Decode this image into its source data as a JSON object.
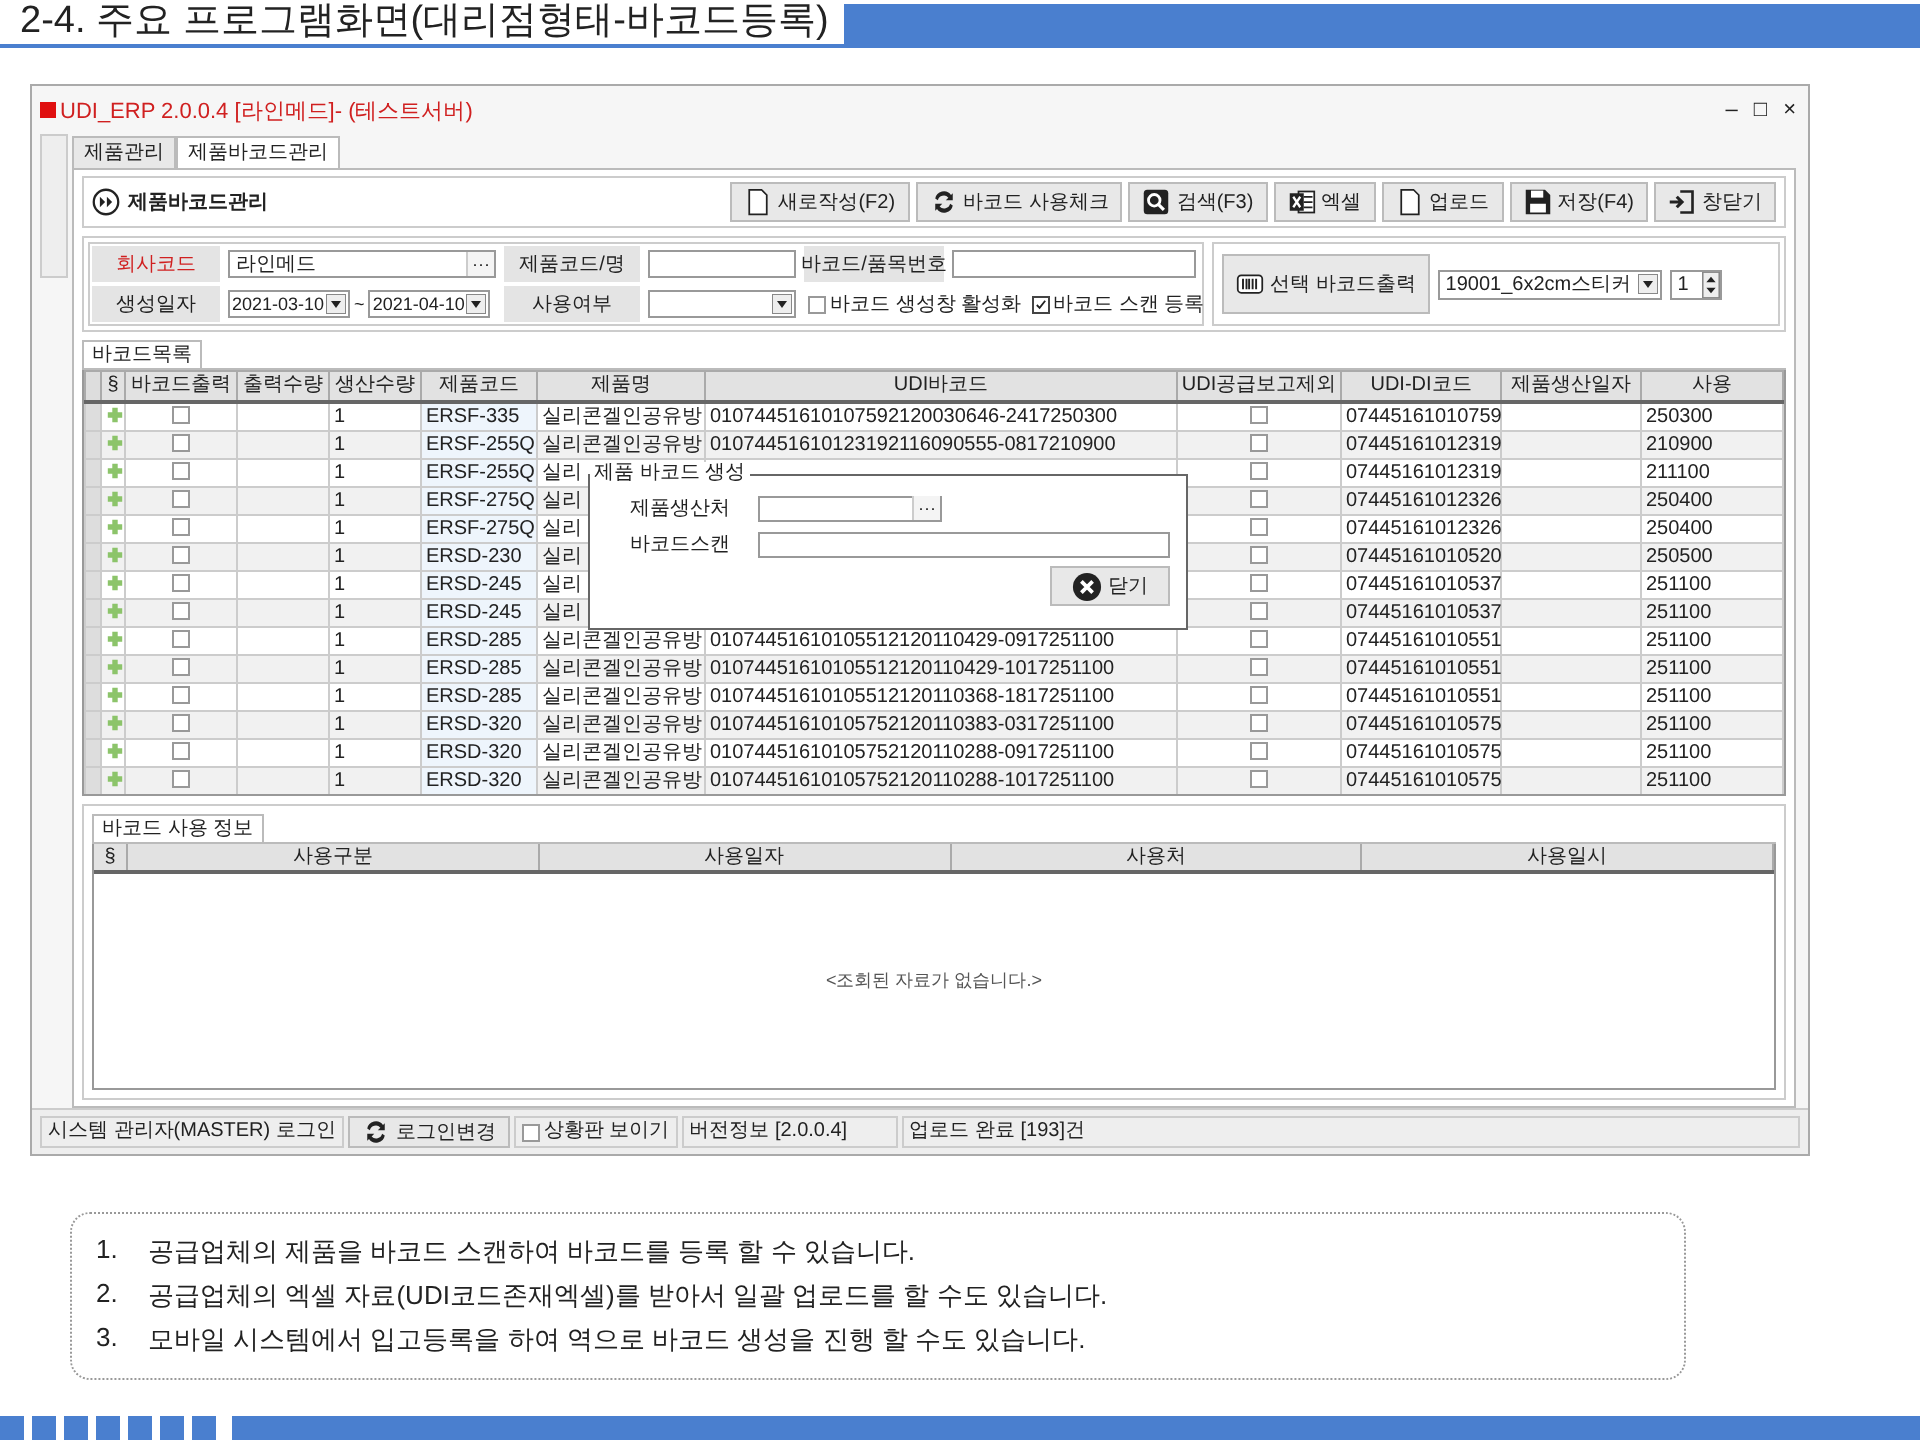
{
  "slide_title": "2-4. 주요 프로그램화면(대리점형태-바코드등록)",
  "window": {
    "title": "UDI_ERP 2.0.0.4 [라인메드]- (테스트서버)",
    "controls": [
      "–",
      "□",
      "×"
    ]
  },
  "tabs": [
    {
      "label": "제품관리",
      "selected": false
    },
    {
      "label": "제품바코드관리",
      "selected": true
    }
  ],
  "panel_title": "제품바코드관리",
  "toolbar": [
    "새로작성(F2)",
    "바코드 사용체크",
    "검색(F3)",
    "엑셀",
    "업로드",
    "저장(F4)",
    "창닫기"
  ],
  "filters": {
    "company": {
      "label": "회사코드",
      "value": "라인메드",
      "button": "···"
    },
    "product": {
      "label": "제품코드/명"
    },
    "barcode_no": {
      "label": "바코드/품목번호"
    },
    "date": {
      "label": "생성일자",
      "from": "2021-03-10",
      "separator": "~",
      "to": "2021-04-10"
    },
    "usage": {
      "label": "사용여부"
    },
    "options": [
      {
        "label": "바코드 생성창 활성화",
        "checked": false
      },
      {
        "label": "바코드 스캔 등록",
        "checked": true
      }
    ]
  },
  "print": {
    "button": "선택 바코드출력",
    "template": "19001_6x2cm스티커",
    "copies": "1"
  },
  "grid_tab": "바코드목록",
  "grid": {
    "columns": [
      "§",
      "바코드출력",
      "출력수량",
      "생산수량",
      "제품코드",
      "제품명",
      "UDI바코드",
      "UDI공급보고제외",
      "UDI-DI코드",
      "제품생산일자",
      "사용"
    ],
    "rows": [
      {
        "print": false,
        "qty": "1",
        "code": "ERSF-335",
        "name": "실리콘겔인공유방",
        "barcode": "01074451610107592120030646-2417250300",
        "exclude": false,
        "di": "07445161010759",
        "use": "250300"
      },
      {
        "print": false,
        "qty": "1",
        "code": "ERSF-255Q",
        "name": "실리콘겔인공유방",
        "barcode": "01074451610123192116090555-0817210900",
        "exclude": false,
        "di": "07445161012319",
        "use": "210900"
      },
      {
        "print": false,
        "qty": "1",
        "code": "ERSF-255Q",
        "name": "실리",
        "exclude": false,
        "di": "07445161012319",
        "use": "211100"
      },
      {
        "print": false,
        "qty": "1",
        "code": "ERSF-275Q",
        "name": "실리",
        "exclude": false,
        "di": "07445161012326",
        "use": "250400"
      },
      {
        "print": false,
        "qty": "1",
        "code": "ERSF-275Q",
        "name": "실리",
        "exclude": false,
        "di": "07445161012326",
        "use": "250400"
      },
      {
        "print": false,
        "qty": "1",
        "code": "ERSD-230",
        "name": "실리",
        "exclude": false,
        "di": "07445161010520",
        "use": "250500"
      },
      {
        "print": false,
        "qty": "1",
        "code": "ERSD-245",
        "name": "실리",
        "exclude": false,
        "di": "07445161010537",
        "use": "251100"
      },
      {
        "print": false,
        "qty": "1",
        "code": "ERSD-245",
        "name": "실리",
        "exclude": false,
        "di": "07445161010537",
        "use": "251100"
      },
      {
        "print": false,
        "qty": "1",
        "code": "ERSD-285",
        "name": "실리콘겔인공유방",
        "barcode": "01074451610105512120110429-0917251100",
        "exclude": false,
        "di": "07445161010551",
        "use": "251100"
      },
      {
        "print": false,
        "qty": "1",
        "code": "ERSD-285",
        "name": "실리콘겔인공유방",
        "barcode": "01074451610105512120110429-1017251100",
        "exclude": false,
        "di": "07445161010551",
        "use": "251100"
      },
      {
        "print": false,
        "qty": "1",
        "code": "ERSD-285",
        "name": "실리콘겔인공유방",
        "barcode": "01074451610105512120110368-1817251100",
        "exclude": false,
        "di": "07445161010551",
        "use": "251100"
      },
      {
        "print": false,
        "qty": "1",
        "code": "ERSD-320",
        "name": "실리콘겔인공유방",
        "barcode": "01074451610105752120110383-0317251100",
        "exclude": false,
        "di": "07445161010575",
        "use": "251100"
      },
      {
        "print": false,
        "qty": "1",
        "code": "ERSD-320",
        "name": "실리콘겔인공유방",
        "barcode": "01074451610105752120110288-0917251100",
        "exclude": false,
        "di": "07445161010575",
        "use": "251100"
      },
      {
        "print": false,
        "qty": "1",
        "code": "ERSD-320",
        "name": "실리콘겔인공유방",
        "barcode": "01074451610105752120110288-1017251100",
        "exclude": false,
        "di": "07445161010575",
        "use": "251100"
      }
    ]
  },
  "dialog": {
    "title": "제품 바코드 생성",
    "fields": [
      {
        "label": "제품생산처",
        "button": "···"
      },
      {
        "label": "바코드스캔"
      }
    ],
    "close": "닫기"
  },
  "usage_tab": "바코드 사용 정보",
  "usage_grid": {
    "columns": [
      "§",
      "사용구분",
      "사용일자",
      "사용처",
      "사용일시"
    ],
    "empty": "<조회된 자료가 없습니다.>"
  },
  "status_bar": {
    "user": "시스템 관리자(MASTER) 로그인",
    "switch_button": "로그인변경",
    "dashboard": {
      "label": "상황판 보이기",
      "checked": false
    },
    "version": "버전정보 [2.0.0.4]",
    "message": "업로드 완료 [193]건"
  },
  "notes": [
    {
      "number": "1.",
      "text": "공급업체의 제품을 바코드 스캔하여 바코드를 등록 할 수 있습니다."
    },
    {
      "number": "2.",
      "text": "공급업체의 엑셀 자료(UDI코드존재엑셀)를 받아서 일괄 업로드를 할 수도 있습니다."
    },
    {
      "number": "3.",
      "text": "모바일 시스템에서 입고등록을 하여 역으로 바코드 생성을 진행 할 수도 있습니다."
    }
  ]
}
